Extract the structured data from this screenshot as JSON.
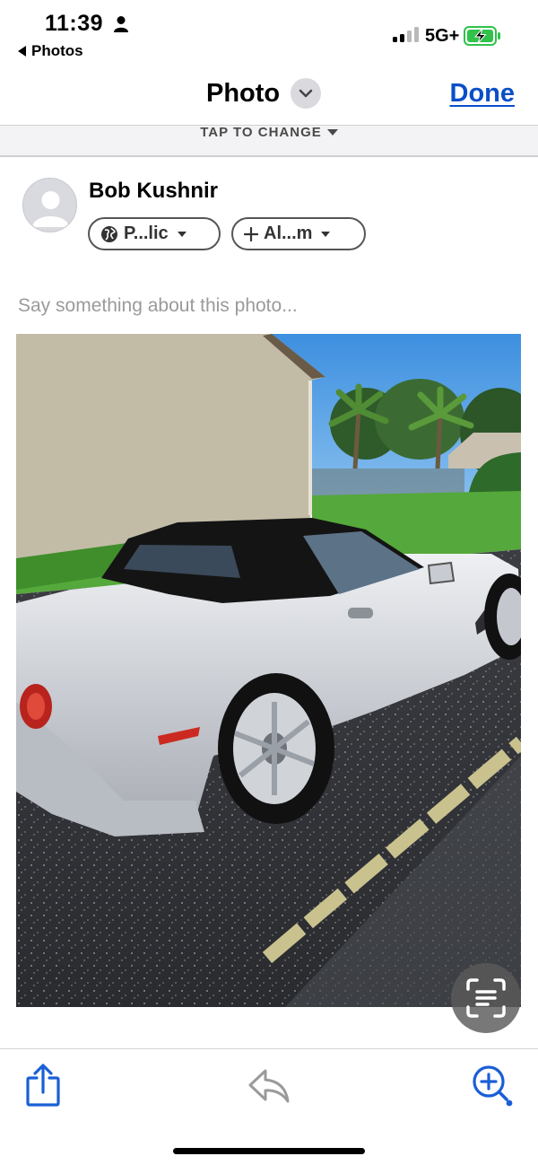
{
  "status_bar": {
    "time": "11:39",
    "back_app": "Photos",
    "network": "5G+",
    "icons": [
      "person-icon",
      "signal-icon",
      "battery-charging-icon"
    ]
  },
  "nav": {
    "title": "Photo",
    "done_label": "Done",
    "tap_to_change": "TAP TO CHANGE"
  },
  "composer": {
    "user_name": "Bob Kushnir",
    "privacy_label": "P...lic",
    "album_label": "Al...m",
    "caption_placeholder": "Say something about this photo..."
  },
  "toolbar": {
    "icons": [
      "share-icon",
      "reply-icon",
      "zoom-in-icon"
    ]
  },
  "colors": {
    "accent": "#0a4fc7",
    "placeholder": "#9a9a9a"
  }
}
